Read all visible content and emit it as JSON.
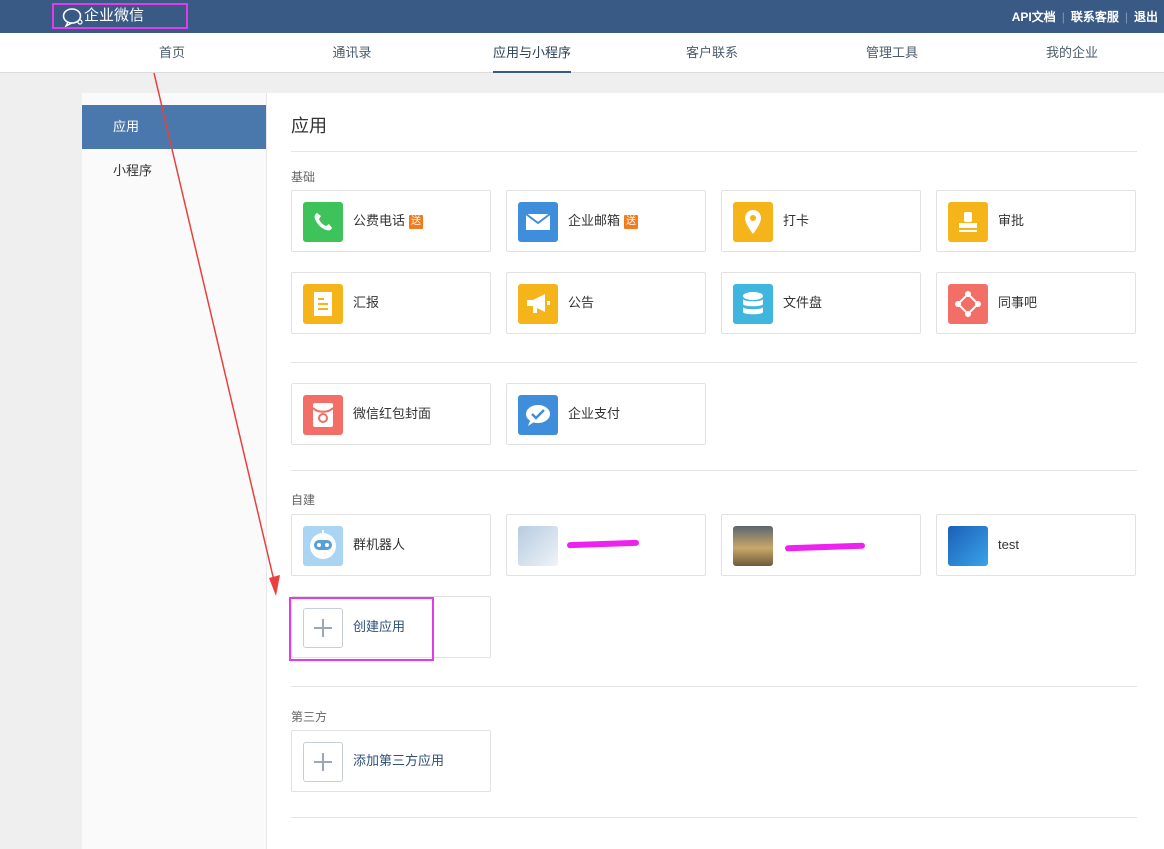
{
  "header": {
    "logo_text": "企业微信",
    "links": [
      "API文档",
      "联系客服",
      "退出"
    ]
  },
  "nav": {
    "tabs": [
      "首页",
      "通讯录",
      "应用与小程序",
      "客户联系",
      "管理工具",
      "我的企业"
    ],
    "active": "应用与小程序"
  },
  "sidebar": {
    "items": [
      "应用",
      "小程序"
    ]
  },
  "main": {
    "title": "应用",
    "sections": {
      "basic": "基础",
      "custom": "自建",
      "third": "第三方"
    },
    "basic_apps": [
      {
        "label": "公费电话",
        "badge": "送",
        "icon": "phone-icon",
        "color": "#3dc35a"
      },
      {
        "label": "企业邮箱",
        "badge": "送",
        "icon": "mail-icon",
        "color": "#3f8edb"
      },
      {
        "label": "打卡",
        "badge": "",
        "icon": "location-pin-icon",
        "color": "#f4b41a"
      },
      {
        "label": "审批",
        "badge": "",
        "icon": "stamp-icon",
        "color": "#f4b41a"
      },
      {
        "label": "汇报",
        "badge": "",
        "icon": "report-icon",
        "color": "#f4b41a"
      },
      {
        "label": "公告",
        "badge": "",
        "icon": "megaphone-icon",
        "color": "#f4b41a"
      },
      {
        "label": "文件盘",
        "badge": "",
        "icon": "database-icon",
        "color": "#3fb6dd"
      },
      {
        "label": "同事吧",
        "badge": "",
        "icon": "network-icon",
        "color": "#f26e66"
      }
    ],
    "extra_apps": [
      {
        "label": "微信红包封面",
        "icon": "red-envelope-icon",
        "color": "#f26e66"
      },
      {
        "label": "企业支付",
        "icon": "payment-icon",
        "color": "#3f8edb"
      }
    ],
    "custom_apps": [
      {
        "label": "群机器人",
        "icon": "robot-icon"
      },
      {
        "label": "",
        "icon": "app-thumbnail-icon"
      },
      {
        "label": "",
        "icon": "landscape-thumbnail-icon"
      },
      {
        "label": "test",
        "icon": "blue-thumbnail-icon"
      }
    ],
    "create_app": "创建应用",
    "add_third_party": "添加第三方应用"
  },
  "colors": {
    "topbar": "#3a5a86",
    "highlight": "#e03ce8",
    "arrow": "#e84040",
    "active_side": "#4a78ad"
  }
}
